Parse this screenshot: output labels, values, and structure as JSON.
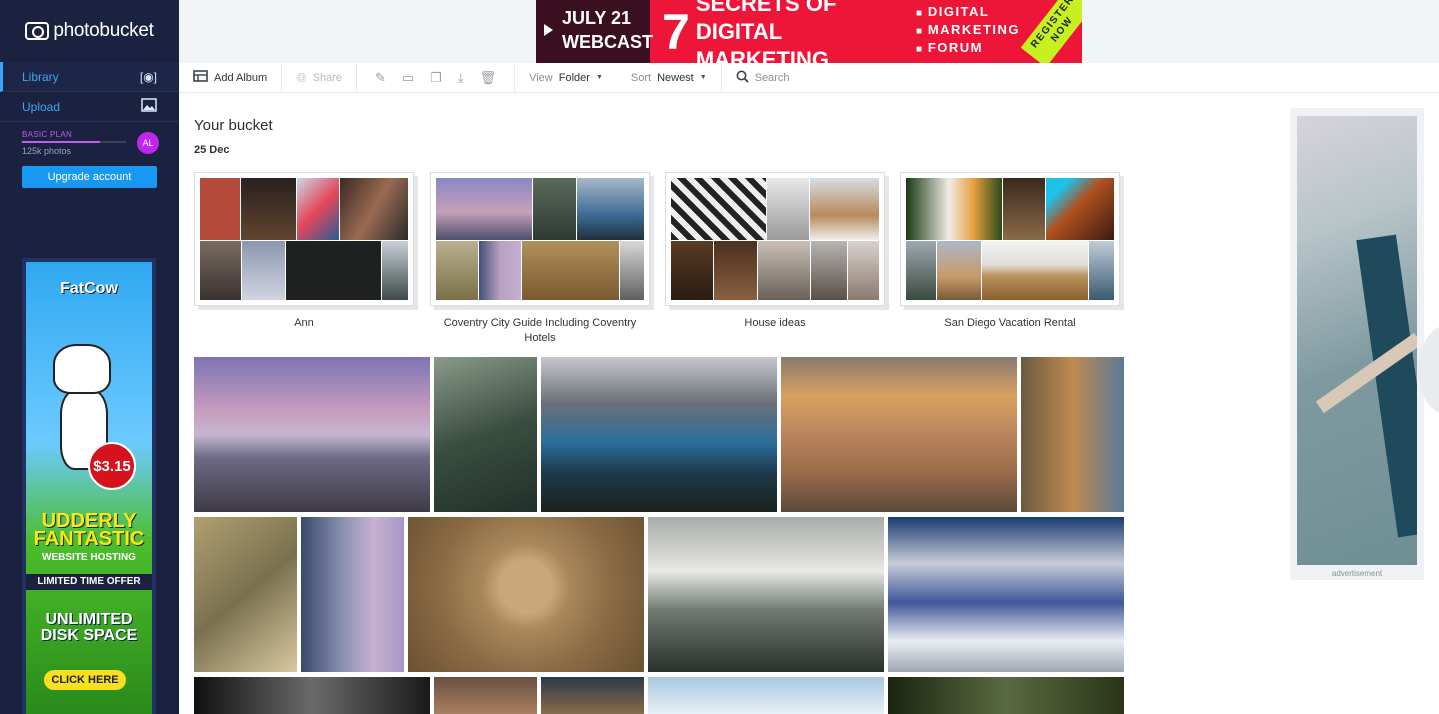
{
  "brand": {
    "name": "photobucket"
  },
  "sidebar": {
    "items": [
      {
        "label": "Library",
        "icon": "library-icon"
      },
      {
        "label": "Upload",
        "icon": "image-upload-icon"
      }
    ],
    "plan": {
      "name": "BASIC PLAN",
      "count": "125k photos",
      "avatar": "AL",
      "usage_fraction": 0.75
    },
    "upgrade_label": "Upgrade account",
    "ad": {
      "brand": "FatCow",
      "price": "$3.15",
      "headline1": "UDDERLY",
      "headline2": "FANTASTIC",
      "headline3": "WEBSITE HOSTING",
      "offer": "LIMITED TIME OFFER",
      "unlimited1": "UNLIMITED",
      "unlimited2": "DISK SPACE",
      "cta": "CLICK HERE"
    }
  },
  "banner": {
    "date_line1": "JULY 21",
    "date_line2": "WEBCAST",
    "number": "7",
    "title_line1": "SECRETS OF DIGITAL",
    "title_line2": "MARKETING",
    "forum_line1": "DIGITAL",
    "forum_line2": "MARKETING",
    "forum_line3": "FORUM",
    "register": "REGISTER NOW"
  },
  "toolbar": {
    "add_album": "Add Album",
    "share": "Share",
    "view_label": "View",
    "view_value": "Folder",
    "sort_label": "Sort",
    "sort_value": "Newest",
    "search_placeholder": "Search"
  },
  "main": {
    "title": "Your bucket",
    "date": "25 Dec",
    "albums": [
      {
        "name": "Ann"
      },
      {
        "name": "Coventry City Guide Including Coventry Hotels"
      },
      {
        "name": "House ideas"
      },
      {
        "name": "San Diego Vacation Rental"
      }
    ]
  },
  "right_ad": {
    "label": "advertisement"
  },
  "colors": {
    "sidebar_bg": "#1b2240",
    "accent_blue": "#1898f0",
    "plan_purple": "#c05cf0",
    "banner_red": "#ee1638"
  }
}
